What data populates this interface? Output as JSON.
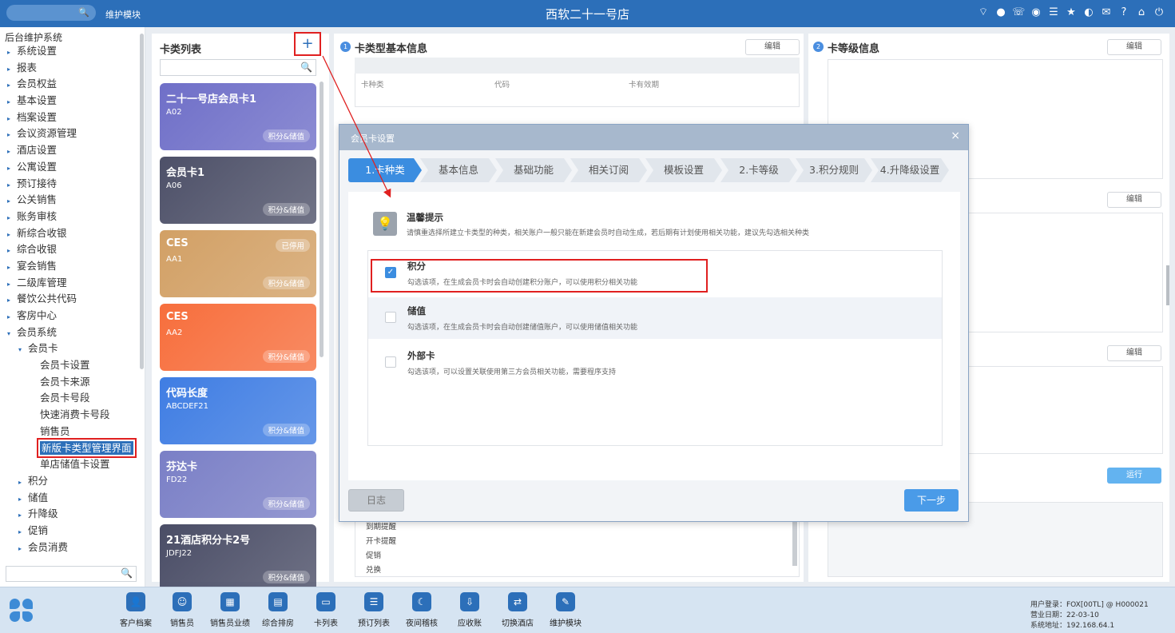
{
  "topbar": {
    "module": "维护模块",
    "store": "西软二十一号店",
    "icons": [
      "wifi-icon",
      "chat-icon",
      "phone-icon",
      "palette-icon",
      "menu-icon",
      "star-icon",
      "moon-icon",
      "mail-icon",
      "help-icon",
      "home-icon",
      "power-icon"
    ]
  },
  "leftnav": {
    "title": "后台维护系统",
    "items": [
      {
        "label": "系统设置",
        "level": 1,
        "arrow": "▸"
      },
      {
        "label": "报表",
        "level": 1,
        "arrow": "▸"
      },
      {
        "label": "会员权益",
        "level": 1,
        "arrow": "▸"
      },
      {
        "label": "基本设置",
        "level": 1,
        "arrow": "▸"
      },
      {
        "label": "档案设置",
        "level": 1,
        "arrow": "▸"
      },
      {
        "label": "会议资源管理",
        "level": 1,
        "arrow": "▸"
      },
      {
        "label": "酒店设置",
        "level": 1,
        "arrow": "▸"
      },
      {
        "label": "公寓设置",
        "level": 1,
        "arrow": "▸"
      },
      {
        "label": "预订接待",
        "level": 1,
        "arrow": "▸"
      },
      {
        "label": "公关销售",
        "level": 1,
        "arrow": "▸"
      },
      {
        "label": "账务审核",
        "level": 1,
        "arrow": "▸"
      },
      {
        "label": "新综合收银",
        "level": 1,
        "arrow": "▸"
      },
      {
        "label": "综合收银",
        "level": 1,
        "arrow": "▸"
      },
      {
        "label": "宴会销售",
        "level": 1,
        "arrow": "▸"
      },
      {
        "label": "二级库管理",
        "level": 1,
        "arrow": "▸"
      },
      {
        "label": "餐饮公共代码",
        "level": 1,
        "arrow": "▸"
      },
      {
        "label": "客房中心",
        "level": 1,
        "arrow": "▸"
      },
      {
        "label": "会员系统",
        "level": 1,
        "arrow": "▾"
      },
      {
        "label": "会员卡",
        "level": 2,
        "arrow": "▾"
      },
      {
        "label": "会员卡设置",
        "level": 3,
        "arrow": ""
      },
      {
        "label": "会员卡来源",
        "level": 3,
        "arrow": ""
      },
      {
        "label": "会员卡号段",
        "level": 3,
        "arrow": ""
      },
      {
        "label": "快速消费卡号段",
        "level": 3,
        "arrow": ""
      },
      {
        "label": "销售员",
        "level": 3,
        "arrow": ""
      },
      {
        "label": "新版卡类型管理界面",
        "level": 3,
        "arrow": "",
        "selected": true
      },
      {
        "label": "单店储值卡设置",
        "level": 3,
        "arrow": ""
      },
      {
        "label": "积分",
        "level": 2,
        "arrow": "▸"
      },
      {
        "label": "储值",
        "level": 2,
        "arrow": "▸"
      },
      {
        "label": "升降级",
        "level": 2,
        "arrow": "▸"
      },
      {
        "label": "促销",
        "level": 2,
        "arrow": "▸"
      },
      {
        "label": "会员消费",
        "level": 2,
        "arrow": "▸"
      }
    ]
  },
  "cardlist": {
    "title": "卡类列表",
    "add_label": "+",
    "cards": [
      {
        "name": "二十一号店会员卡1",
        "code": "A02",
        "tag": "积分&储值",
        "status": "",
        "color": "#6f6fc8"
      },
      {
        "name": "会员卡1",
        "code": "A06",
        "tag": "积分&储值",
        "status": "",
        "color": "#4d5068"
      },
      {
        "name": "CES",
        "code": "AA1",
        "tag": "积分&储值",
        "status": "已停用",
        "color": "#d2a065"
      },
      {
        "name": "CES",
        "code": "AA2",
        "tag": "积分&储值",
        "status": "",
        "color": "#f76e3c"
      },
      {
        "name": "代码长度",
        "code": "ABCDEF21",
        "tag": "积分&储值",
        "status": "",
        "color": "#3f7de3"
      },
      {
        "name": "芬达卡",
        "code": "FD22",
        "tag": "积分&储值",
        "status": "",
        "color": "#7a7fc6"
      },
      {
        "name": "21酒店积分卡2号",
        "code": "JDFJ22",
        "tag": "积分&储值",
        "status": "",
        "color": "#4a4d66"
      }
    ]
  },
  "info1": {
    "num": "1",
    "title": "卡类型基本信息",
    "edit": "编辑",
    "cols": [
      "卡种类",
      "代码",
      "卡有效期"
    ],
    "rows": [
      "到期提醒",
      "开卡提醒",
      "促销",
      "兑换"
    ]
  },
  "info2": {
    "num": "2",
    "title": "卡等级信息",
    "edit": "编辑",
    "run": "运行"
  },
  "modal": {
    "title": "会员卡设置",
    "close": "×",
    "steps": [
      "1.卡种类",
      "基本信息",
      "基础功能",
      "相关订阅",
      "模板设置",
      "2.卡等级",
      "3.积分规则",
      "4.升降级设置"
    ],
    "tip_title": "温馨提示",
    "tip_text": "请慎重选择所建立卡类型的种类，相关账户一般只能在新建会员时自动生成，若后期有计划使用相关功能，建议先勾选相关种类",
    "options": [
      {
        "title": "积分",
        "desc": "勾选该项，在生成会员卡时会自动创建积分账户，可以使用积分相关功能",
        "checked": true
      },
      {
        "title": "储值",
        "desc": "勾选该项，在生成会员卡时会自动创建储值账户，可以使用储值相关功能",
        "checked": false
      },
      {
        "title": "外部卡",
        "desc": "勾选该项，可以设置关联使用第三方会员相关功能，需要程序支持",
        "checked": false
      }
    ],
    "log_btn": "日志",
    "next_btn": "下一步"
  },
  "dock": {
    "items": [
      {
        "label": "客户档案",
        "icon": "customer-icon",
        "glyph": "👤"
      },
      {
        "label": "销售员",
        "icon": "salesperson-icon",
        "glyph": "☺"
      },
      {
        "label": "销售员业绩",
        "icon": "chart-icon",
        "glyph": "▦"
      },
      {
        "label": "综合排房",
        "icon": "room-icon",
        "glyph": "▤"
      },
      {
        "label": "卡列表",
        "icon": "card-icon",
        "glyph": "▭"
      },
      {
        "label": "预订列表",
        "icon": "booking-icon",
        "glyph": "☰"
      },
      {
        "label": "夜间稽核",
        "icon": "night-audit-icon",
        "glyph": "☾"
      },
      {
        "label": "应收账",
        "icon": "receivable-icon",
        "glyph": "⇩"
      },
      {
        "label": "切换酒店",
        "icon": "switch-icon",
        "glyph": "⇄"
      },
      {
        "label": "维护模块",
        "icon": "wrench-icon",
        "glyph": "✎"
      }
    ],
    "user": "用户登录：FOX[00TL] @ H000021",
    "date": "营业日期：22-03-10",
    "address": "系统地址：192.168.64.1"
  }
}
